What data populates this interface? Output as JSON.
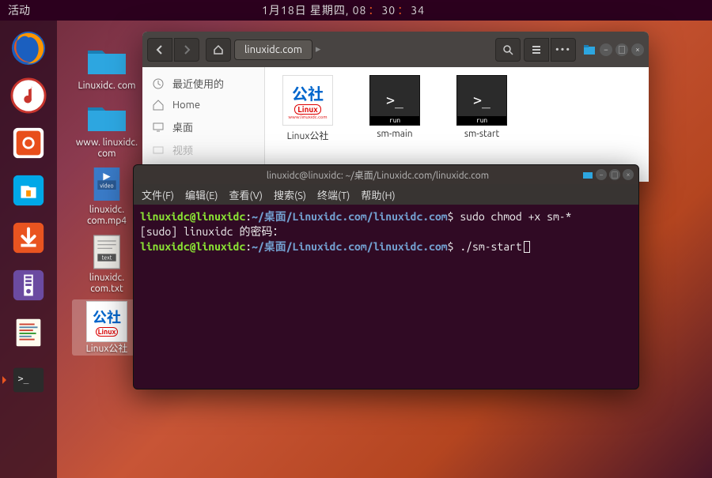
{
  "topbar": {
    "activities": "活动",
    "date": "1月18日 星期四,",
    "h": "08",
    "m": "30",
    "s": "34"
  },
  "launcher": {
    "apps": [
      "firefox",
      "rhythmbox",
      "screenshot",
      "files",
      "software",
      "archive",
      "text-editor",
      "terminal"
    ]
  },
  "desktop": {
    "folder1": "Linuxidc.\ncom",
    "folder2": "www.\nlinuxidc.\ncom",
    "video": "linuxidc.\ncom.mp4",
    "text": "linuxidc.\ncom.txt",
    "image": "Linux公社"
  },
  "files": {
    "breadcrumb": "linuxidc.com",
    "sidebar": {
      "recent": "最近使用的",
      "home": "Home",
      "desktop": "桌面",
      "videos": "视频"
    },
    "items": {
      "img": "Linux公社",
      "exec1": "sm-main",
      "exec2": "sm-start"
    },
    "gongshe": "公社",
    "linux_small": "Linux",
    "url_small": "www.linuxidc.com"
  },
  "terminal": {
    "title": "linuxidc@linuxidc: ~/桌面/Linuxidc.com/linuxidc.com",
    "menu": {
      "file": "文件(F)",
      "edit": "编辑(E)",
      "view": "查看(V)",
      "search": "搜索(S)",
      "term": "终端(T)",
      "help": "帮助(H)"
    },
    "prompt_user": "linuxidc@linuxidc",
    "prompt_path": "~/桌面/Linuxidc.com/linuxidc.com",
    "cmd1": " sudo chmod +x sm-*",
    "sudo_line": "[sudo] linuxidc 的密码：",
    "cmd2": " ./sm-start"
  }
}
